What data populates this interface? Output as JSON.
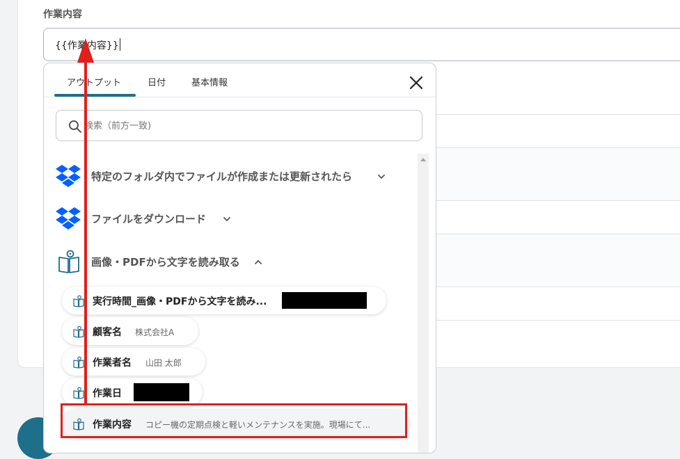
{
  "field": {
    "label": "作業内容",
    "value": "{{作業内容}}"
  },
  "popup": {
    "tabs": [
      "アウトプット",
      "日付",
      "基本情報"
    ],
    "active_tab": 0,
    "close_icon": "close-icon",
    "search": {
      "placeholder": "検索（前方一致)",
      "icon": "search-icon"
    },
    "sections": [
      {
        "title": "特定のフォルダ内でファイルが作成または更新されたら",
        "icon": "dropbox-icon",
        "expanded": false
      },
      {
        "title": "ファイルをダウンロード",
        "icon": "dropbox-icon",
        "expanded": false
      },
      {
        "title": "画像・PDFから文字を読み取る",
        "icon": "ocr-book-icon",
        "expanded": true
      }
    ],
    "items": [
      {
        "label": "実行時間_画像・PDFから文字を読み...",
        "value": "",
        "redacted": true
      },
      {
        "label": "顧客名",
        "value": "株式会社A",
        "redacted": false
      },
      {
        "label": "作業者名",
        "value": "山田 太郎",
        "redacted": false
      },
      {
        "label": "作業日",
        "value": "",
        "redacted": true
      },
      {
        "label": "作業内容",
        "value": "コピー機の定期点検と軽いメンテナンスを実施。現場にて...",
        "redacted": false
      }
    ]
  },
  "colors": {
    "accent": "#1f6e8c",
    "dropbox": "#0061fe",
    "annotation": "#e0201b"
  }
}
